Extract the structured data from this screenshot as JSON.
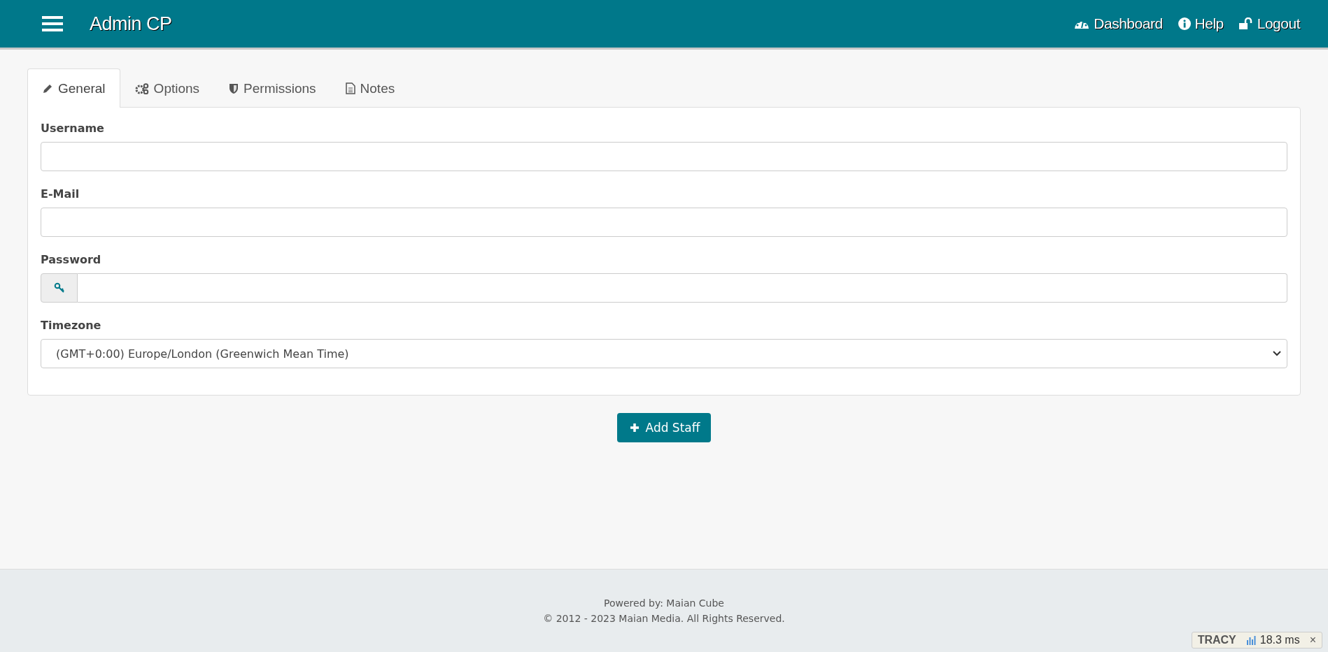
{
  "header": {
    "title": "Admin CP",
    "nav": [
      {
        "label": "Dashboard"
      },
      {
        "label": "Help"
      },
      {
        "label": "Logout"
      }
    ]
  },
  "tabs": [
    {
      "label": "General",
      "selected": true
    },
    {
      "label": "Options",
      "selected": false
    },
    {
      "label": "Permissions",
      "selected": false
    },
    {
      "label": "Notes",
      "selected": false
    }
  ],
  "fields": [
    {
      "label": "Username",
      "kind": "text"
    },
    {
      "label": "E-Mail",
      "kind": "text"
    },
    {
      "label": "Password",
      "kind": "password"
    },
    {
      "label": "Timezone",
      "kind": "select",
      "value": "(GMT+0:00) Europe/London (Greenwich Mean Time)"
    }
  ],
  "submit": {
    "label": "Add Staff"
  },
  "footer": {
    "powered": "Powered by: Maian Cube",
    "copyright": "© 2012 - 2023 Maian Media. All Rights Reserved."
  },
  "debug_bar": {
    "label": "TRACY",
    "time": "18.3 ms",
    "close": "×"
  }
}
